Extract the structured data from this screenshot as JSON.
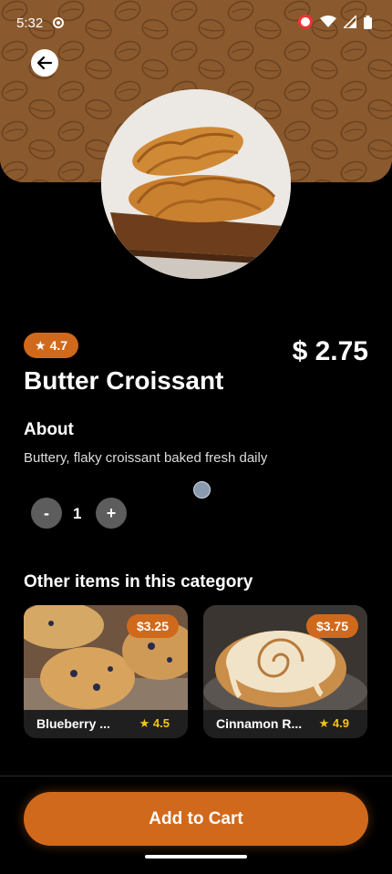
{
  "status": {
    "time": "5:32"
  },
  "product": {
    "rating": "4.7",
    "price": "$ 2.75",
    "title": "Butter Croissant",
    "about_heading": "About",
    "about_text": "Buttery, flaky croissant baked fresh daily",
    "quantity": "1",
    "minus_label": "-",
    "plus_label": "+"
  },
  "other": {
    "heading": "Other items in this category",
    "items": [
      {
        "name": "Blueberry ...",
        "price": "$3.25",
        "rating": "4.5"
      },
      {
        "name": "Cinnamon R...",
        "price": "$3.75",
        "rating": "4.9"
      }
    ]
  },
  "cart": {
    "label": "Add to Cart"
  },
  "colors": {
    "accent": "#d0691c",
    "header": "#8a5a2e",
    "star": "#f5c518",
    "background": "#000000"
  },
  "icons": {
    "back": "arrow-left-icon",
    "star": "star-icon"
  }
}
